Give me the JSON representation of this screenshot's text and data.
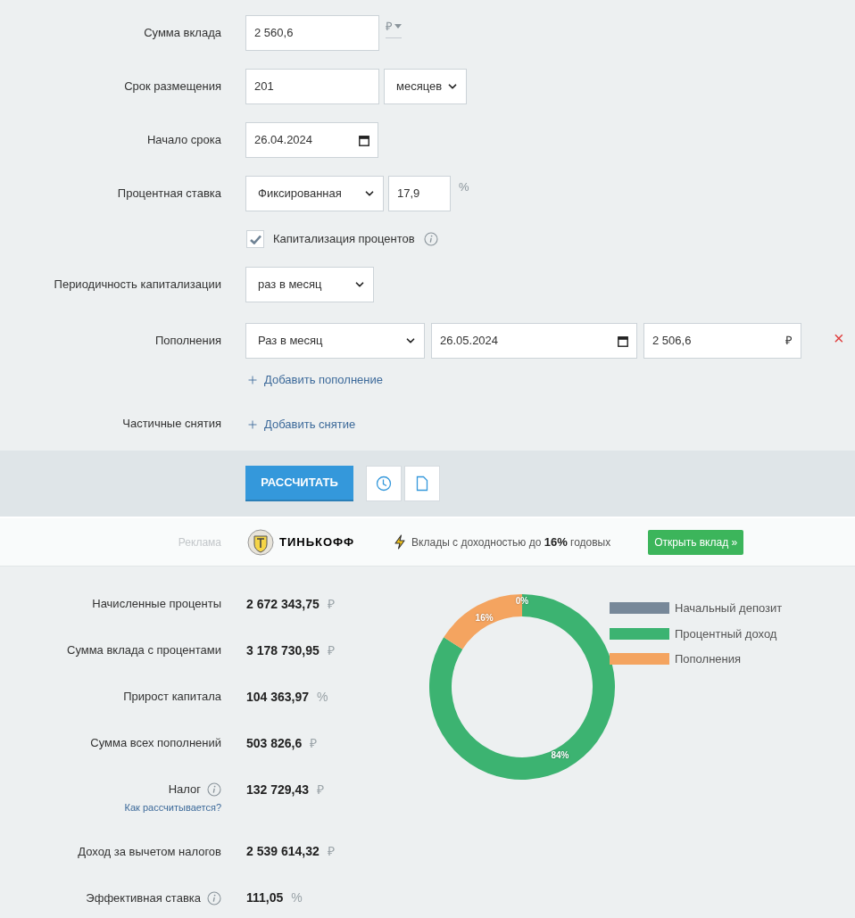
{
  "deposit_amount": {
    "label": "Сумма вклада",
    "value": "2 560,6",
    "currency": "₽"
  },
  "term": {
    "label": "Срок размещения",
    "value": "201",
    "unit": "месяцев"
  },
  "start_date": {
    "label": "Начало срока",
    "value": "26.04.2024"
  },
  "interest_rate": {
    "label": "Процентная ставка",
    "type": "Фиксированная",
    "value": "17,9",
    "unit": "%"
  },
  "capitalization": {
    "label": "Капитализация процентов",
    "checked": true
  },
  "capitalization_period": {
    "label": "Периодичность капитализации",
    "value": "раз в месяц"
  },
  "top_ups": {
    "label": "Пополнения",
    "items": [
      {
        "frequency": "Раз в месяц",
        "date": "26.05.2024",
        "amount": "2 506,6",
        "currency": "₽",
        "remove": "×"
      }
    ],
    "add_link": "Добавить пополнение"
  },
  "withdrawals": {
    "label": "Частичные снятия",
    "add_link": "Добавить снятие"
  },
  "actions": {
    "calculate": "РАССЧИТАТЬ"
  },
  "ad": {
    "label": "Реклама",
    "brand": "ТИНЬКОФФ",
    "text": "Вклады с доходностью до **16%** годовых",
    "button": "Открыть вклад »"
  },
  "results": [
    {
      "label": "Начисленные проценты",
      "value": "2 672 343,75",
      "unit": "₽",
      "info": false
    },
    {
      "label": "Сумма вклада с процентами",
      "value": "3 178 730,95",
      "unit": "₽",
      "info": false
    },
    {
      "label": "Прирост капитала",
      "value": "104 363,97",
      "unit": "%",
      "info": false
    },
    {
      "label": "Сумма всех пополнений",
      "value": "503 826,6",
      "unit": "₽",
      "info": false
    },
    {
      "label": "Налог",
      "value": "132 729,43",
      "unit": "₽",
      "info": true,
      "link": "Как рассчитывается?"
    },
    {
      "label": "Доход за вычетом налогов",
      "value": "2 539 614,32",
      "unit": "₽",
      "info": false
    },
    {
      "label": "Эффективная ставка",
      "value": "111,05",
      "unit": "%",
      "info": true
    }
  ],
  "chart_data": {
    "type": "donut",
    "categories": [
      "Начальный депозит",
      "Процентный доход",
      "Пополнения"
    ],
    "values": [
      0,
      84,
      16
    ],
    "value_labels": [
      "0%",
      "84%",
      "16%"
    ],
    "colors": [
      "#778899",
      "#3cb371",
      "#f4a460"
    ]
  }
}
